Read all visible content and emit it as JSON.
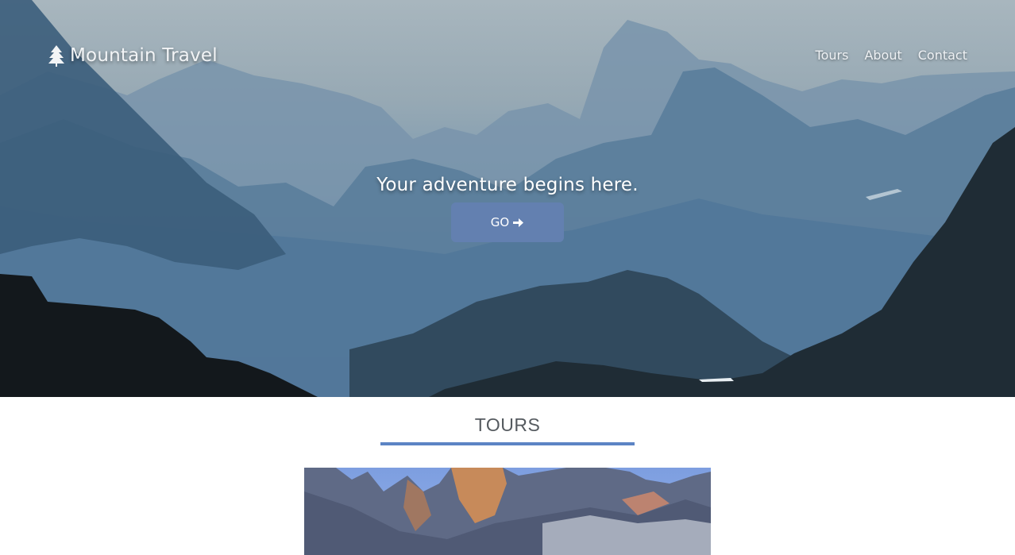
{
  "brand": {
    "name": "Mountain Travel",
    "icon": "tree-icon"
  },
  "nav": {
    "items": [
      {
        "label": "Tours"
      },
      {
        "label": "About"
      },
      {
        "label": "Contact"
      }
    ]
  },
  "hero": {
    "tagline": "Your adventure begins here.",
    "button_label": "GO",
    "button_icon": "arrow-right-icon"
  },
  "tours": {
    "heading": "TOURS"
  },
  "colors": {
    "accent": "#6380b0",
    "rule": "#5c84c4",
    "heading": "#555a5f"
  }
}
